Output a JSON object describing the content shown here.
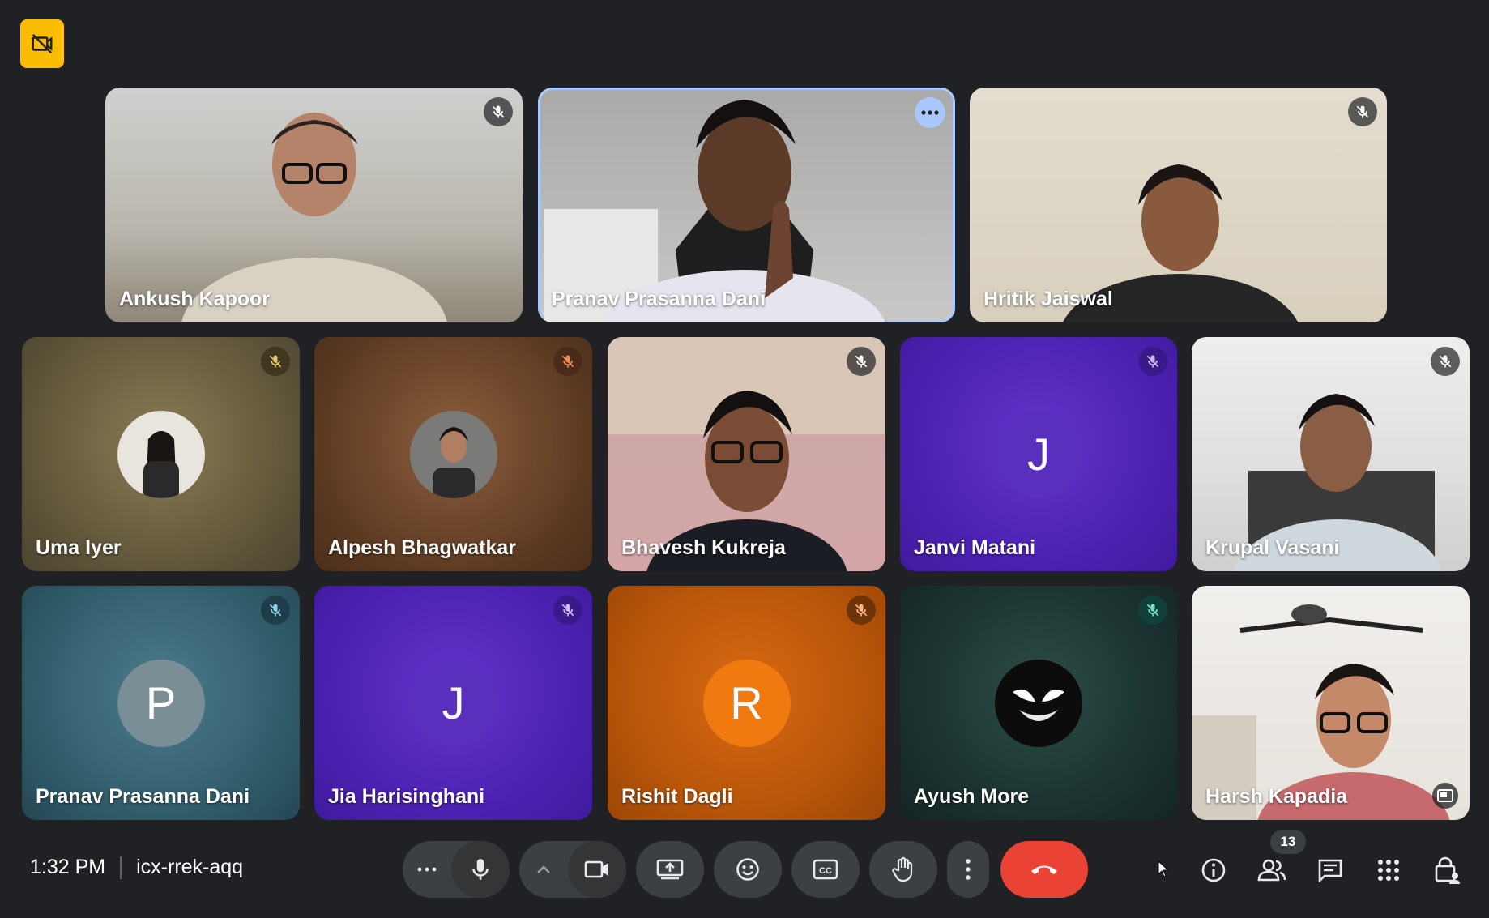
{
  "colors": {
    "bg": "#202124",
    "accent": "#a8c7fa",
    "leave": "#ea4335",
    "badge": "#fbbc04"
  },
  "top_badge": {
    "icon": "no-video-feed-icon"
  },
  "participants": [
    {
      "name": "Ankush Kapoor",
      "mic": "muted",
      "type": "video"
    },
    {
      "name": "Pranav Prasanna Dani",
      "mic": "speaking",
      "type": "video",
      "active": true
    },
    {
      "name": "Hritik Jaiswal",
      "mic": "muted",
      "type": "video"
    },
    {
      "name": "Uma Iyer",
      "mic": "muted",
      "type": "photo"
    },
    {
      "name": "Alpesh Bhagwatkar",
      "mic": "muted",
      "type": "photo"
    },
    {
      "name": "Bhavesh Kukreja",
      "mic": "muted",
      "type": "video"
    },
    {
      "name": "Janvi Matani",
      "mic": "muted",
      "type": "initial",
      "initial": "J"
    },
    {
      "name": "Krupal Vasani",
      "mic": "muted",
      "type": "video"
    },
    {
      "name": "Pranav Prasanna Dani",
      "mic": "muted",
      "type": "initial",
      "initial": "P"
    },
    {
      "name": "Jia Harisinghani",
      "mic": "muted",
      "type": "initial",
      "initial": "J"
    },
    {
      "name": "Rishit Dagli",
      "mic": "muted",
      "type": "initial",
      "initial": "R"
    },
    {
      "name": "Ayush More",
      "mic": "muted",
      "type": "photo"
    },
    {
      "name": "Harsh Kapadia",
      "mic": "none",
      "type": "video"
    }
  ],
  "meeting": {
    "time": "1:32 PM",
    "code": "icx-rrek-aqq"
  },
  "controls": {
    "more_audio": "more-options-icon",
    "mic": "microphone-icon",
    "expand": "chevron-up-icon",
    "camera": "camera-icon",
    "present": "present-screen-icon",
    "reactions": "emoji-icon",
    "captions": "captions-icon",
    "raise_hand": "raise-hand-icon",
    "more": "more-vert-icon",
    "leave": "leave-call-icon"
  },
  "right_controls": {
    "people_count": "13"
  }
}
